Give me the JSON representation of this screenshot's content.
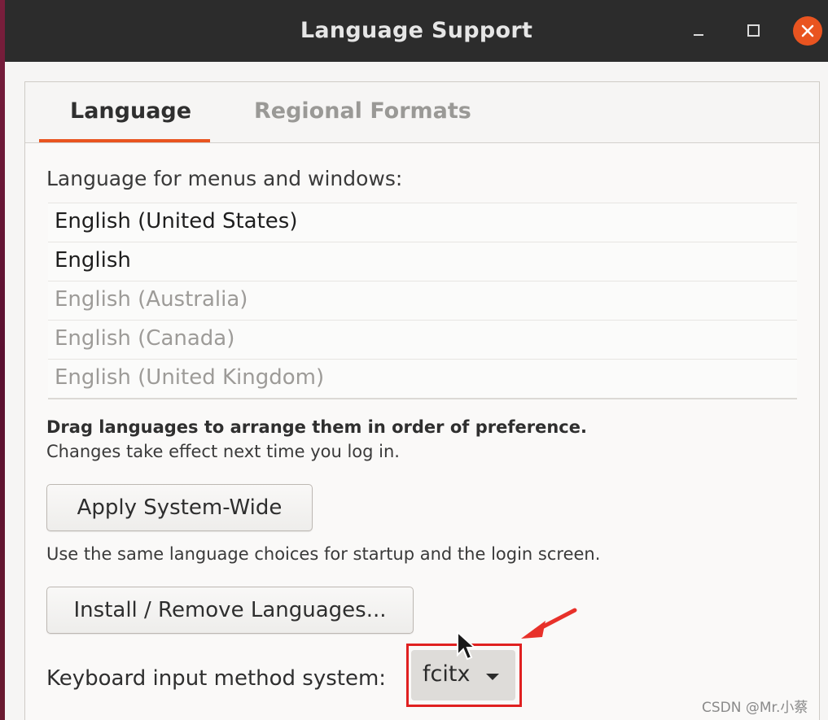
{
  "window": {
    "title": "Language Support",
    "controls": [
      "minimize-icon",
      "maximize-icon",
      "close-icon"
    ]
  },
  "tabs": [
    {
      "label": "Language",
      "active": true
    },
    {
      "label": "Regional Formats",
      "active": false
    }
  ],
  "language_section": {
    "label": "Language for menus and windows:",
    "items": [
      {
        "label": "English (United States)",
        "state": "active"
      },
      {
        "label": "English",
        "state": "active"
      },
      {
        "label": "English (Australia)",
        "state": "inactive"
      },
      {
        "label": "English (Canada)",
        "state": "inactive"
      },
      {
        "label": "English (United Kingdom)",
        "state": "inactive"
      }
    ]
  },
  "hints": {
    "drag": "Drag languages to arrange them in order of preference.",
    "effect": "Changes take effect next time you log in."
  },
  "buttons": {
    "apply": "Apply System-Wide",
    "apply_note": "Use the same language choices for startup and the login screen.",
    "install": "Install / Remove Languages..."
  },
  "keyboard": {
    "label": "Keyboard input method system:",
    "value": "fcitx"
  },
  "watermark": "CSDN @Mr.小蔡",
  "colors": {
    "accent": "#e95420",
    "highlight": "#e02020",
    "titlebar": "#2c2c2c"
  }
}
